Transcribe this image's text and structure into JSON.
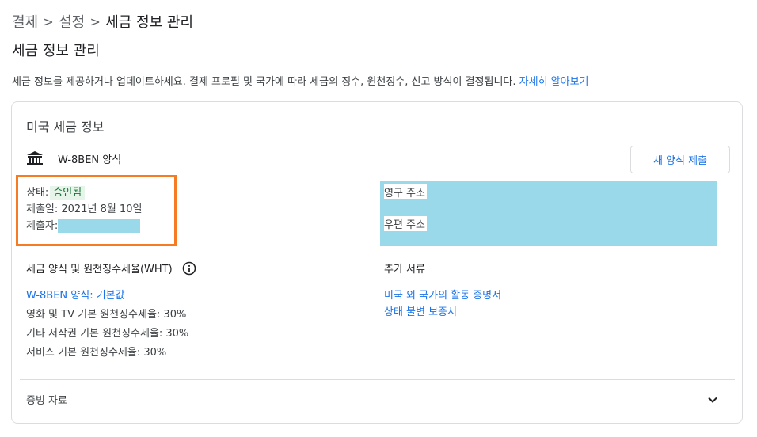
{
  "breadcrumb": {
    "items": [
      "결제",
      "설정",
      "세금 정보 관리"
    ],
    "separator": ">"
  },
  "page": {
    "title": "세금 정보 관리",
    "description": "세금 정보를 제공하거나 업데이트하세요. 결제 프로필 및 국가에 따라 세금의 징수, 원천징수, 신고 방식이 결정됩니다.",
    "learn_more": "자세히 알아보기"
  },
  "card": {
    "title": "미국 세금 정보",
    "form_name": "W-8BEN 양식",
    "new_form_button": "새 양식 제출",
    "status_label": "상태:",
    "status_value": "승인됨",
    "submitted_date": "제출일: 2021년 8월 10일",
    "submitter_label": "제출자:",
    "permanent_address_label": "영구 주소",
    "mailing_address_label": "우편 주소",
    "wht_title": "세금 양식 및 원천징수세율(WHT)",
    "wht_items": [
      "W-8BEN 양식: 기본값",
      "영화 및 TV 기본 원천징수세율: 30%",
      "기타 저작권 기본 원천징수세율: 30%",
      "서비스 기본 원천징수세율: 30%"
    ],
    "extra_docs_title": "추가 서류",
    "extra_docs": [
      "미국 외 국가의 활동 증명서",
      "상태 불변 보증서"
    ],
    "evidence_label": "증빙 자료"
  },
  "colors": {
    "link": "#1a73e8",
    "status_badge_bg": "#e6f4ea",
    "status_badge_text": "#137333",
    "highlight_box": "#f57c22",
    "redaction": "#99d9ea"
  },
  "icons": {
    "form": "bank-icon",
    "info": "info-icon",
    "expand": "chevron-down-icon",
    "breadcrumb_sep": "chevron-right"
  }
}
